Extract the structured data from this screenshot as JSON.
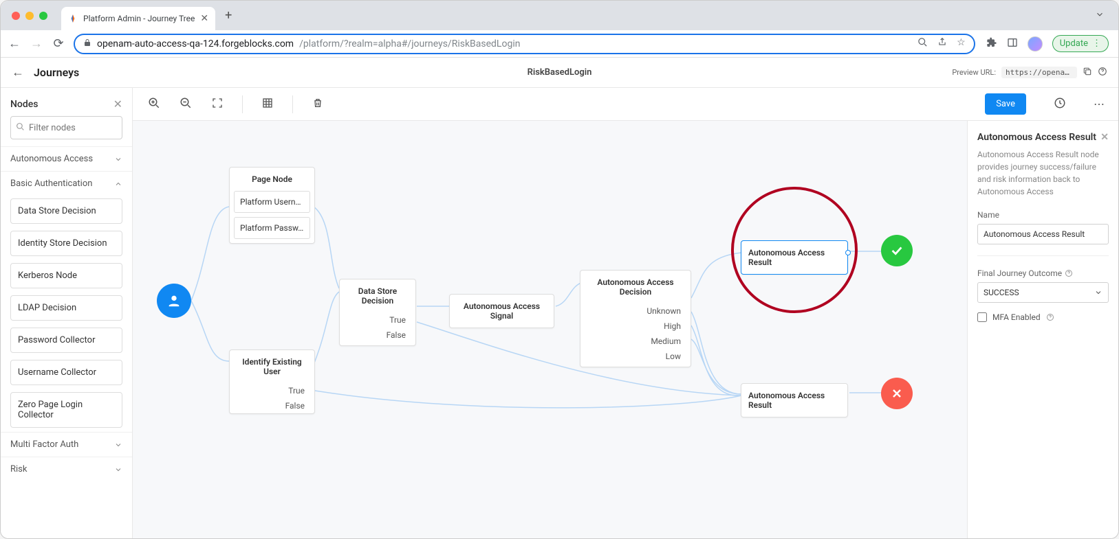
{
  "browser": {
    "tab_title": "Platform Admin - Journey Tree",
    "url_host": "openam-auto-access-qa-124.forgeblocks.com",
    "url_path": "/platform/?realm=alpha#/journeys/RiskBasedLogin",
    "update_label": "Update"
  },
  "header": {
    "page_title": "Journeys",
    "journey_name": "RiskBasedLogin",
    "preview_label": "Preview URL:",
    "preview_value": "https://openam-auto…"
  },
  "sidebar": {
    "title": "Nodes",
    "filter_placeholder": "Filter nodes",
    "groups": [
      {
        "label": "Autonomous Access",
        "expanded": false
      },
      {
        "label": "Basic Authentication",
        "expanded": true,
        "items": [
          "Data Store Decision",
          "Identity Store Decision",
          "Kerberos Node",
          "LDAP Decision",
          "Password Collector",
          "Username Collector",
          "Zero Page Login Collector"
        ]
      },
      {
        "label": "Multi Factor Auth",
        "expanded": false
      },
      {
        "label": "Risk",
        "expanded": false
      }
    ]
  },
  "toolbar": {
    "save": "Save"
  },
  "canvas": {
    "page_node": {
      "title": "Page Node",
      "sub1": "Platform Usern…",
      "sub2": "Platform Passw…"
    },
    "identify": {
      "title": "Identify Existing User",
      "out1": "True",
      "out2": "False"
    },
    "dsd": {
      "title": "Data Store Decision",
      "out1": "True",
      "out2": "False"
    },
    "signal": {
      "title": "Autonomous Access Signal"
    },
    "decision": {
      "title": "Autonomous Access Decision",
      "o1": "Unknown",
      "o2": "High",
      "o3": "Medium",
      "o4": "Low"
    },
    "result1": {
      "title": "Autonomous Access Result"
    },
    "result2": {
      "title": "Autonomous Access Result"
    }
  },
  "panel": {
    "title": "Autonomous Access Result",
    "desc": "Autonomous Access Result node provides journey success/failure and risk information back to Autonomous Access",
    "name_label": "Name",
    "name_value": "Autonomous Access Result",
    "outcome_label": "Final Journey Outcome",
    "outcome_value": "SUCCESS",
    "mfa_label": "MFA Enabled"
  }
}
